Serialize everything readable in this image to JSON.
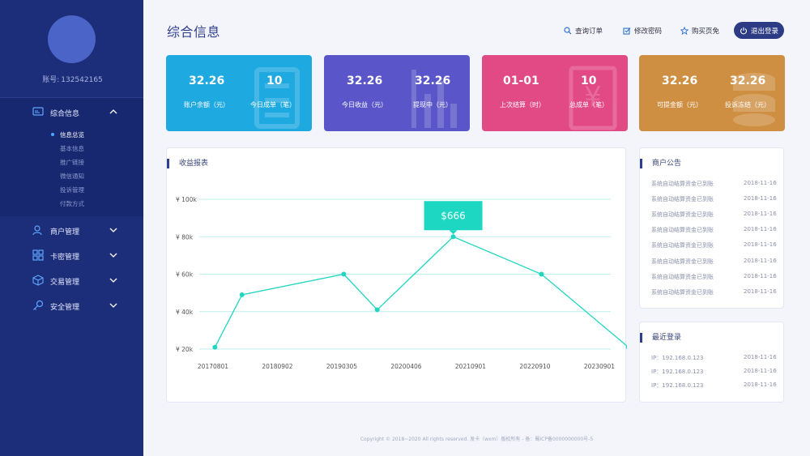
{
  "sidebar": {
    "account_label": "账号:",
    "account_value": "132542165",
    "items": [
      {
        "label": "综合信息",
        "icon": "dashboard-icon"
      },
      {
        "label": "商户管理",
        "icon": "users-icon"
      },
      {
        "label": "卡密管理",
        "icon": "grid-icon"
      },
      {
        "label": "交易管理",
        "icon": "cube-icon"
      },
      {
        "label": "安全管理",
        "icon": "key-icon"
      }
    ],
    "sub_items": [
      "信息总览",
      "基本信息",
      "推广链接",
      "微信通知",
      "投诉管理",
      "付款方式"
    ]
  },
  "header": {
    "title": "综合信息",
    "links": [
      {
        "label": "查询订单",
        "icon": "search-icon"
      },
      {
        "label": "修改密码",
        "icon": "edit-icon"
      },
      {
        "label": "购买页免",
        "icon": "star-icon"
      }
    ],
    "logout_label": "退出登录"
  },
  "stats": [
    {
      "left_value": "32.26",
      "left_caption": "账户余额（元）",
      "right_value": "10",
      "right_caption": "今日成单（笔）",
      "color": "#1fa9e1"
    },
    {
      "left_value": "32.26",
      "left_caption": "今日收益（元）",
      "right_value": "32.26",
      "right_caption": "提现中（元）",
      "color": "#5a56c9"
    },
    {
      "left_value": "01-01",
      "left_caption": "上次结算（时）",
      "right_value": "10",
      "right_caption": "总成单（笔）",
      "color": "#e24a86"
    },
    {
      "left_value": "32.26",
      "left_caption": "可提金额（元）",
      "right_value": "32.26",
      "right_caption": "投诉冻结（元）",
      "color": "#cf8f42"
    }
  ],
  "report": {
    "title": "收益报表",
    "tooltip": "$666"
  },
  "chart_data": {
    "type": "line",
    "categories": [
      "20170801",
      "20180902",
      "20190305",
      "20200406",
      "20210901",
      "20220910",
      "20230901"
    ],
    "x_tick_labels": [
      "20170801",
      "20180902",
      "20190305",
      "20200406",
      "20210901",
      "20220910",
      "20230901"
    ],
    "y_tick_labels": [
      "¥ 100k",
      "¥ 80k",
      "¥ 60k",
      "¥ 40k",
      "¥ 20k"
    ],
    "y_ticks": [
      100,
      80,
      60,
      40,
      20
    ],
    "points": [
      {
        "x": 0.03,
        "y": 21
      },
      {
        "x": 0.45,
        "y": 49
      },
      {
        "x": 2.03,
        "y": 60
      },
      {
        "x": 2.55,
        "y": 41
      },
      {
        "x": 3.73,
        "y": 80
      },
      {
        "x": 5.1,
        "y": 60
      },
      {
        "x": 6.45,
        "y": 21
      }
    ],
    "ylim": [
      20,
      100
    ],
    "highlight_index": 4,
    "grid": true,
    "line_color": "#20d6c1"
  },
  "notices": {
    "title": "商户公告",
    "rows": [
      {
        "text": "系统自动结算资金已到账",
        "date": "2018-11-16"
      },
      {
        "text": "系统自动结算资金已到账",
        "date": "2018-11-16"
      },
      {
        "text": "系统自动结算资金已到账",
        "date": "2018-11-16"
      },
      {
        "text": "系统自动结算资金已到账",
        "date": "2018-11-16"
      },
      {
        "text": "系统自动结算资金已到账",
        "date": "2018-11-16"
      },
      {
        "text": "系统自动结算资金已到账",
        "date": "2018-11-16"
      },
      {
        "text": "系统自动结算资金已到账",
        "date": "2018-11-16"
      },
      {
        "text": "系统自动结算资金已到账",
        "date": "2018-11-16"
      }
    ]
  },
  "logins": {
    "title": "最近登录",
    "rows": [
      {
        "text": "IP：192.168.0.123",
        "date": "2018-11-16"
      },
      {
        "text": "IP：192.168.0.123",
        "date": "2018-11-16"
      },
      {
        "text": "IP：192.168.0.123",
        "date": "2018-11-16"
      }
    ]
  },
  "footer": "Copyright © 2018~2020 All rights reserved. 发卡（wxm）版权所有 - 备：蜀ICP备0000000000号-5"
}
